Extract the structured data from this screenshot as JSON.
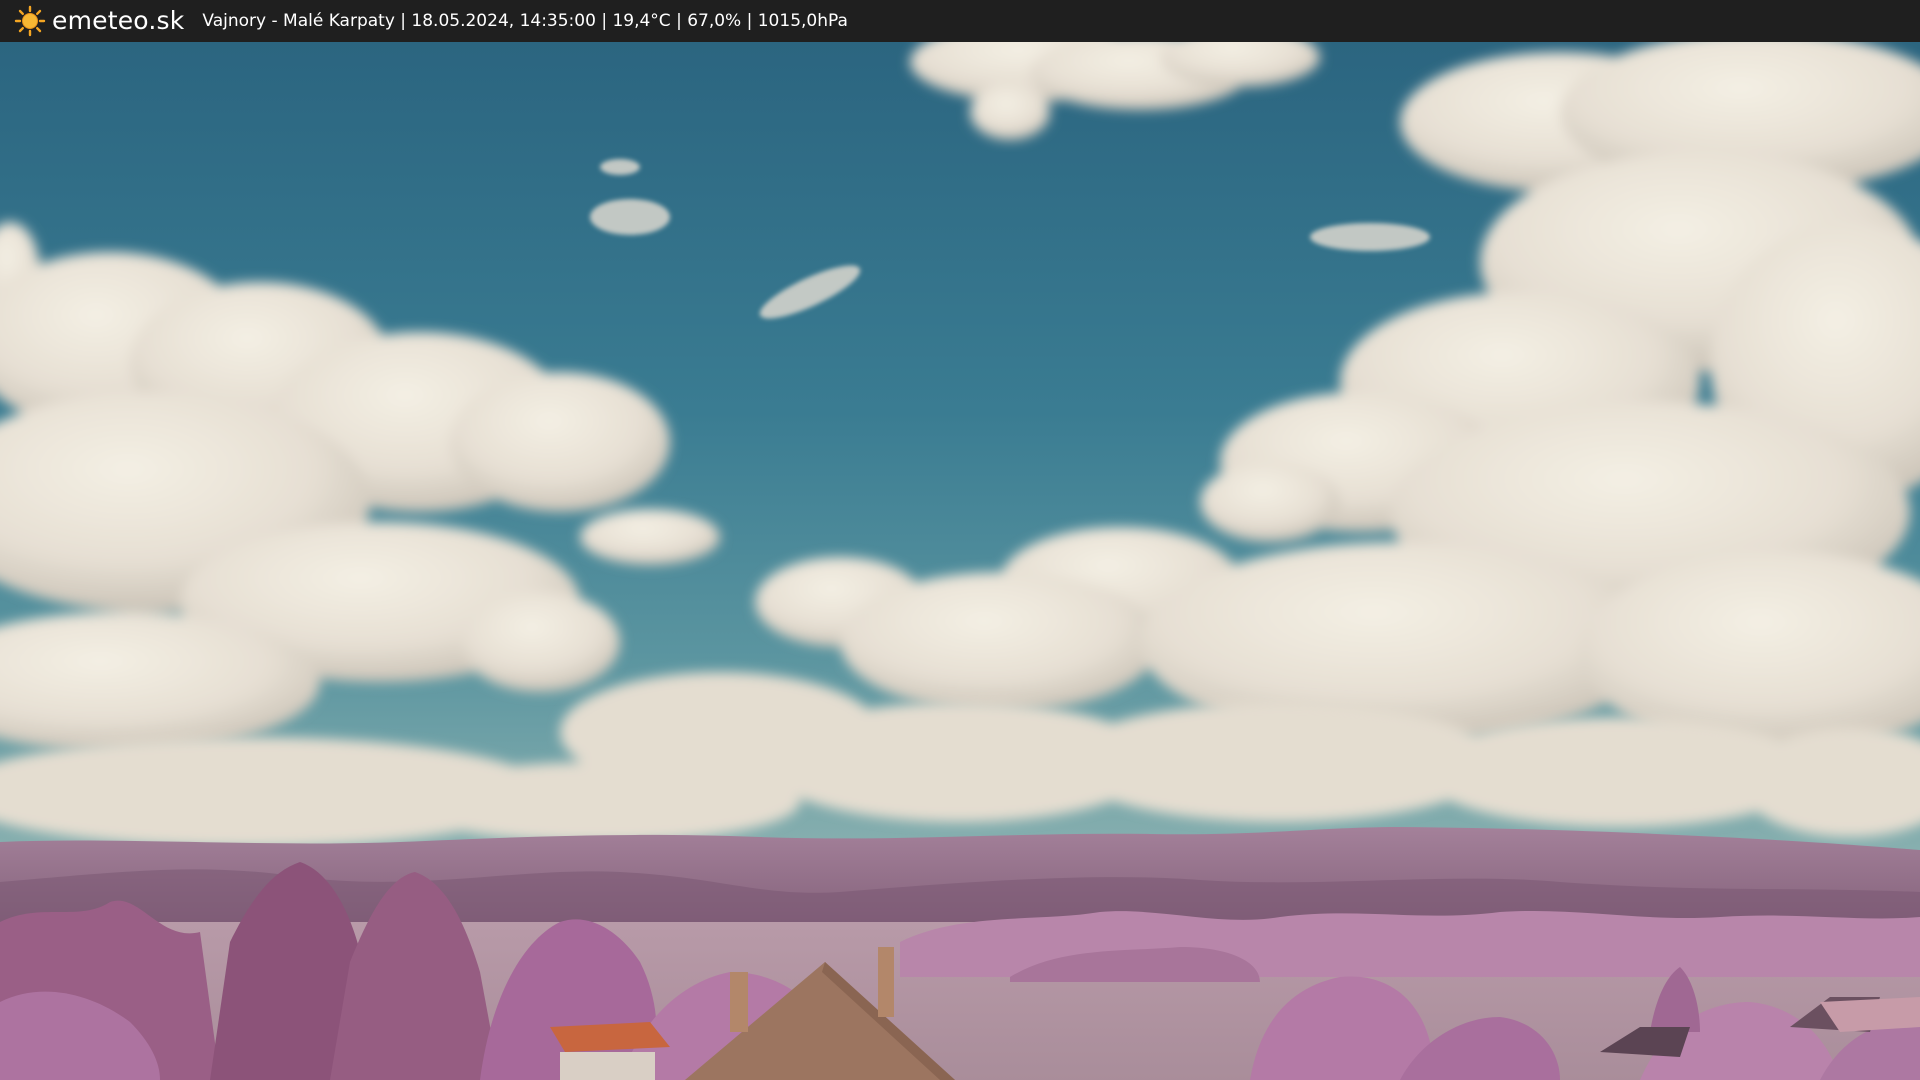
{
  "header": {
    "brand": "emeteo.sk",
    "brand_icon": "sun-icon",
    "caption": "Vajnory - Malé Karpaty | 18.05.2024, 14:35:00 | 19,4°C | 67,0% | 1015,0hPa"
  },
  "colors": {
    "bar": "#1f1f1f",
    "sun": "#f5a623",
    "sky_top": "#2f6c84",
    "sky_mid": "#3f8296",
    "cloud": "#ece6da",
    "cloud_shadow": "#b9b2a8",
    "hills": "#9a7690",
    "foliage": "#b57aa6",
    "roof": "#c8663f"
  }
}
